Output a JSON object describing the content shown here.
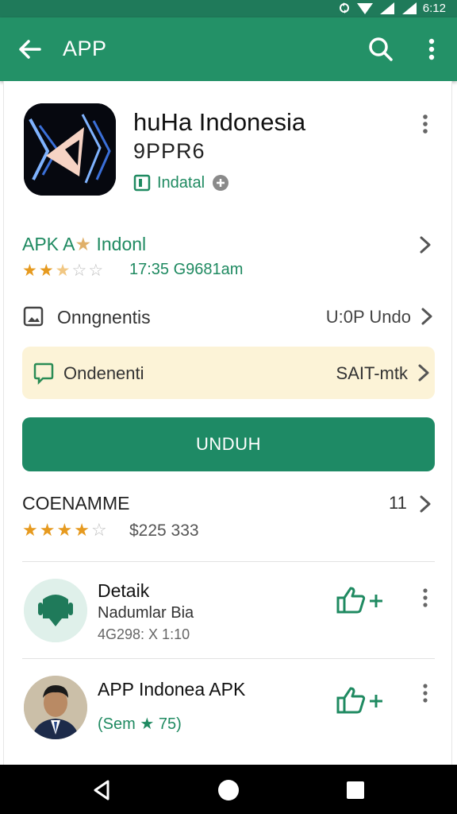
{
  "status_bar": {
    "time": "6:12"
  },
  "app_bar": {
    "title": "APP"
  },
  "app": {
    "name": "huHa Indonesia",
    "developer": "9PPR6",
    "installed_label": "Indatal"
  },
  "rating": {
    "title": "APK A",
    "title_suffix": "Indonl",
    "stars": 2.5,
    "date": "17:35 G9681am"
  },
  "info_row": {
    "label": "Onngnentis",
    "value": "U:0P Undo"
  },
  "highlight_row": {
    "label": "Ondenenti",
    "value": "SAIT-mtk"
  },
  "install_button": {
    "label": "UNDUH"
  },
  "section": {
    "title": "COENAMME",
    "count": "11",
    "stars": 4,
    "price": "$225 333"
  },
  "list": [
    {
      "title": "Detaik",
      "subtitle": "Nadumlar Bia",
      "meta": "4G298: X 1:10"
    },
    {
      "title": "APP Indonea APK",
      "subtitle": "(Sem ★ 75)"
    }
  ],
  "colors": {
    "accent": "#239167",
    "accent_dark": "#1f7a5a",
    "button": "#1e8a65",
    "highlight_bg": "#fcf3d7",
    "star": "#e69a1f"
  },
  "icons": {
    "back": "arrow-left-icon",
    "search": "search-icon",
    "more": "more-vertical-icon",
    "installed": "book-icon",
    "add": "plus-circle-icon",
    "info": "image-icon",
    "highlight": "chat-icon",
    "like": "thumbs-up-plus-icon",
    "nav_back": "triangle-back-icon",
    "nav_home": "circle-home-icon",
    "nav_recent": "square-recent-icon"
  }
}
